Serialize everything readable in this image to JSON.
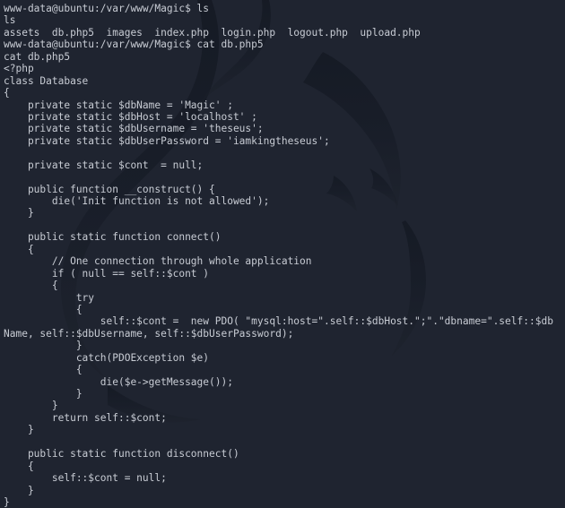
{
  "terminal": {
    "window_kind": "kali-linux-terminal",
    "colors": {
      "background": "#1f2430",
      "foreground": "#c8ccd4",
      "watermark": "#1a1f2a"
    },
    "shell_prompt": "www-data@ubuntu:/var/www/Magic$",
    "user": "www-data",
    "host": "ubuntu",
    "cwd": "/var/www/Magic",
    "commands": [
      "ls",
      "cat db.php5"
    ],
    "listing_entries": [
      "assets",
      "db.php5",
      "images",
      "index.php",
      "login.php",
      "logout.php",
      "upload.php"
    ],
    "file_shown": "db.php5",
    "credentials": {
      "db_name": "Magic",
      "db_host": "localhost",
      "db_username": "theseus",
      "db_user_password": "iamkingtheseus"
    },
    "lines": [
      "www-data@ubuntu:/var/www/Magic$ ls",
      "ls",
      "assets  db.php5  images  index.php  login.php  logout.php  upload.php",
      "www-data@ubuntu:/var/www/Magic$ cat db.php5",
      "cat db.php5",
      "<?php",
      "class Database",
      "{",
      "    private static $dbName = 'Magic' ;",
      "    private static $dbHost = 'localhost' ;",
      "    private static $dbUsername = 'theseus';",
      "    private static $dbUserPassword = 'iamkingtheseus';",
      "",
      "    private static $cont  = null;",
      "",
      "    public function __construct() {",
      "        die('Init function is not allowed');",
      "    }",
      "",
      "    public static function connect()",
      "    {",
      "        // One connection through whole application",
      "        if ( null == self::$cont )",
      "        {",
      "            try",
      "            {",
      "                self::$cont =  new PDO( \"mysql:host=\".self::$dbHost.\";\".\"dbname=\".self::$db",
      "Name, self::$dbUsername, self::$dbUserPassword);",
      "            }",
      "            catch(PDOException $e)",
      "            {",
      "                die($e->getMessage());",
      "            }",
      "        }",
      "        return self::$cont;",
      "    }",
      "",
      "    public static function disconnect()",
      "    {",
      "        self::$cont = null;",
      "    }",
      "}"
    ]
  }
}
